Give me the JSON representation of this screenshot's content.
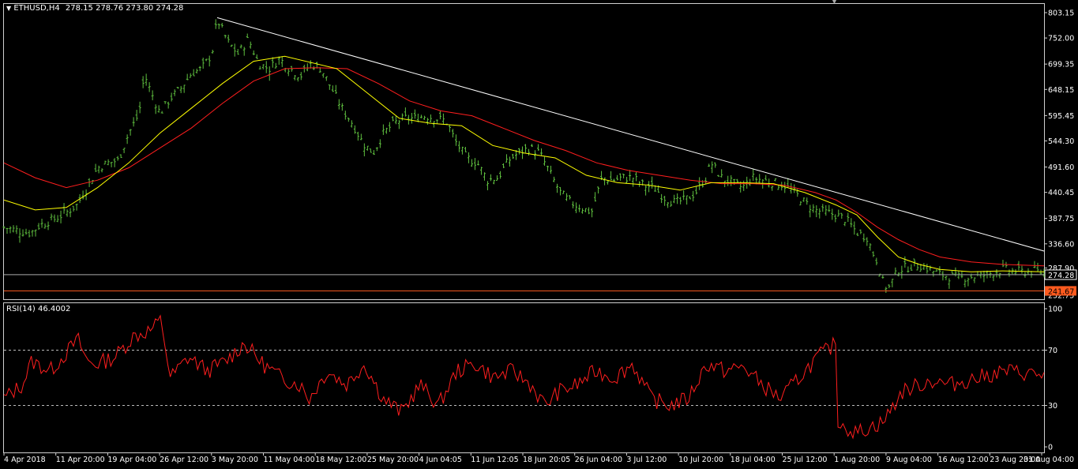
{
  "colors": {
    "background": "#000000",
    "bars": "#5fbf3f",
    "ma_fast": "#ffff00",
    "ma_slow": "#ff1e1e",
    "trendline": "#ffffff",
    "rsi": "#ff1e1e",
    "bid_line": "#aaaaaa",
    "support_line": "#ff5a1e",
    "support_tag": "#ff5a1e",
    "frame": "#cfcfcf"
  },
  "header": {
    "symbol": "ETHUSD,H4",
    "ohlc": "278.15 278.76 273.80 274.28",
    "arrow": "▼",
    "scroll_marker": "▼"
  },
  "rsi_panel": {
    "title": "RSI(14) 46.4002"
  },
  "chart_data": [
    {
      "type": "ohlc",
      "symbol": "ETHUSD",
      "timeframe": "H4",
      "ylim": [
        232.75,
        803.15
      ],
      "y_ticks": [
        "803.15",
        "752.00",
        "699.35",
        "648.15",
        "595.45",
        "544.30",
        "491.60",
        "440.45",
        "387.75",
        "336.60",
        "287.90",
        "232.75"
      ],
      "x_ticks": [
        "4 Apr 2018",
        "11 Apr 20:00",
        "19 Apr 04:00",
        "26 Apr 12:00",
        "3 May 20:00",
        "11 May 04:00",
        "18 May 12:00",
        "25 May 20:00",
        "4 Jun 04:05",
        "11 Jun 12:05",
        "18 Jun 20:05",
        "26 Jun 04:00",
        "3 Jul 12:00",
        "10 Jul 20:00",
        "18 Jul 04:00",
        "25 Jul 12:00",
        "1 Aug 20:00",
        "9 Aug 04:00",
        "16 Aug 12:00",
        "23 Aug 20:00",
        "31 Aug 04:00"
      ],
      "price_path": [
        [
          0,
          370
        ],
        [
          0.01,
          365
        ],
        [
          0.025,
          358
        ],
        [
          0.035,
          375
        ],
        [
          0.05,
          388
        ],
        [
          0.06,
          400
        ],
        [
          0.07,
          415
        ],
        [
          0.08,
          450
        ],
        [
          0.09,
          490
        ],
        [
          0.1,
          500
        ],
        [
          0.11,
          505
        ],
        [
          0.12,
          560
        ],
        [
          0.13,
          600
        ],
        [
          0.135,
          680
        ],
        [
          0.14,
          650
        ],
        [
          0.15,
          600
        ],
        [
          0.16,
          630
        ],
        [
          0.17,
          650
        ],
        [
          0.18,
          680
        ],
        [
          0.19,
          690
        ],
        [
          0.2,
          720
        ],
        [
          0.205,
          790
        ],
        [
          0.215,
          745
        ],
        [
          0.225,
          720
        ],
        [
          0.235,
          750
        ],
        [
          0.245,
          700
        ],
        [
          0.255,
          690
        ],
        [
          0.265,
          710
        ],
        [
          0.275,
          690
        ],
        [
          0.285,
          675
        ],
        [
          0.295,
          700
        ],
        [
          0.305,
          690
        ],
        [
          0.315,
          650
        ],
        [
          0.325,
          610
        ],
        [
          0.335,
          580
        ],
        [
          0.345,
          540
        ],
        [
          0.355,
          520
        ],
        [
          0.365,
          560
        ],
        [
          0.375,
          580
        ],
        [
          0.385,
          590
        ],
        [
          0.395,
          590
        ],
        [
          0.405,
          595
        ],
        [
          0.415,
          590
        ],
        [
          0.425,
          585
        ],
        [
          0.435,
          540
        ],
        [
          0.445,
          510
        ],
        [
          0.455,
          500
        ],
        [
          0.465,
          465
        ],
        [
          0.475,
          470
        ],
        [
          0.485,
          505
        ],
        [
          0.495,
          520
        ],
        [
          0.505,
          530
        ],
        [
          0.515,
          520
        ],
        [
          0.525,
          480
        ],
        [
          0.535,
          440
        ],
        [
          0.545,
          420
        ],
        [
          0.555,
          410
        ],
        [
          0.565,
          400
        ],
        [
          0.575,
          470
        ],
        [
          0.585,
          465
        ],
        [
          0.595,
          470
        ],
        [
          0.605,
          470
        ],
        [
          0.615,
          455
        ],
        [
          0.625,
          450
        ],
        [
          0.635,
          430
        ],
        [
          0.645,
          420
        ],
        [
          0.655,
          425
        ],
        [
          0.665,
          440
        ],
        [
          0.675,
          470
        ],
        [
          0.68,
          500
        ],
        [
          0.69,
          470
        ],
        [
          0.7,
          460
        ],
        [
          0.71,
          450
        ],
        [
          0.72,
          470
        ],
        [
          0.73,
          465
        ],
        [
          0.74,
          460
        ],
        [
          0.75,
          455
        ],
        [
          0.76,
          440
        ],
        [
          0.77,
          420
        ],
        [
          0.78,
          405
        ],
        [
          0.79,
          400
        ],
        [
          0.8,
          395
        ],
        [
          0.81,
          385
        ],
        [
          0.82,
          360
        ],
        [
          0.83,
          350
        ],
        [
          0.835,
          320
        ],
        [
          0.84,
          300
        ],
        [
          0.845,
          260
        ],
        [
          0.85,
          245
        ],
        [
          0.86,
          285
        ],
        [
          0.87,
          290
        ],
        [
          0.88,
          295
        ],
        [
          0.89,
          285
        ],
        [
          0.9,
          275
        ],
        [
          0.91,
          270
        ],
        [
          0.92,
          268
        ],
        [
          0.93,
          270
        ],
        [
          0.94,
          272
        ],
        [
          0.95,
          278
        ],
        [
          0.96,
          285
        ],
        [
          0.97,
          282
        ],
        [
          0.98,
          280
        ],
        [
          0.99,
          282
        ],
        [
          1,
          278
        ]
      ],
      "ma_fast_path": [
        [
          0,
          425
        ],
        [
          0.03,
          405
        ],
        [
          0.06,
          410
        ],
        [
          0.09,
          450
        ],
        [
          0.12,
          500
        ],
        [
          0.15,
          560
        ],
        [
          0.18,
          610
        ],
        [
          0.21,
          660
        ],
        [
          0.24,
          705
        ],
        [
          0.27,
          715
        ],
        [
          0.3,
          700
        ],
        [
          0.32,
          690
        ],
        [
          0.35,
          640
        ],
        [
          0.38,
          590
        ],
        [
          0.41,
          580
        ],
        [
          0.44,
          575
        ],
        [
          0.47,
          535
        ],
        [
          0.5,
          520
        ],
        [
          0.53,
          510
        ],
        [
          0.56,
          475
        ],
        [
          0.59,
          460
        ],
        [
          0.62,
          455
        ],
        [
          0.65,
          445
        ],
        [
          0.68,
          460
        ],
        [
          0.71,
          460
        ],
        [
          0.74,
          458
        ],
        [
          0.77,
          440
        ],
        [
          0.8,
          415
        ],
        [
          0.82,
          395
        ],
        [
          0.84,
          350
        ],
        [
          0.86,
          310
        ],
        [
          0.88,
          295
        ],
        [
          0.9,
          285
        ],
        [
          0.93,
          280
        ],
        [
          0.96,
          282
        ],
        [
          1,
          280
        ]
      ],
      "ma_slow_path": [
        [
          0,
          500
        ],
        [
          0.03,
          470
        ],
        [
          0.06,
          450
        ],
        [
          0.09,
          465
        ],
        [
          0.12,
          490
        ],
        [
          0.15,
          530
        ],
        [
          0.18,
          570
        ],
        [
          0.21,
          620
        ],
        [
          0.24,
          665
        ],
        [
          0.27,
          690
        ],
        [
          0.3,
          692
        ],
        [
          0.33,
          690
        ],
        [
          0.36,
          660
        ],
        [
          0.39,
          625
        ],
        [
          0.42,
          605
        ],
        [
          0.45,
          595
        ],
        [
          0.48,
          570
        ],
        [
          0.51,
          545
        ],
        [
          0.54,
          525
        ],
        [
          0.57,
          500
        ],
        [
          0.6,
          485
        ],
        [
          0.63,
          475
        ],
        [
          0.66,
          465
        ],
        [
          0.69,
          458
        ],
        [
          0.72,
          458
        ],
        [
          0.75,
          455
        ],
        [
          0.78,
          440
        ],
        [
          0.8,
          425
        ],
        [
          0.82,
          400
        ],
        [
          0.84,
          370
        ],
        [
          0.86,
          345
        ],
        [
          0.88,
          325
        ],
        [
          0.9,
          310
        ],
        [
          0.93,
          300
        ],
        [
          0.96,
          295
        ],
        [
          1,
          292
        ]
      ],
      "trendline": {
        "start": [
          0.205,
          793
        ],
        "end": [
          1,
          322
        ]
      },
      "bid_price": 274.28,
      "bid_label": "274.28",
      "support_level": 241.67,
      "support_label": "241.67"
    },
    {
      "type": "line",
      "name": "RSI(14)",
      "ylim": [
        0,
        100
      ],
      "y_ticks": [
        "100",
        "70",
        "30",
        "0"
      ],
      "levels": [
        70,
        30
      ],
      "rsi_path": [
        [
          0,
          35
        ],
        [
          0.02,
          45
        ],
        [
          0.03,
          62
        ],
        [
          0.05,
          55
        ],
        [
          0.07,
          70
        ],
        [
          0.08,
          78
        ],
        [
          0.09,
          62
        ],
        [
          0.1,
          60
        ],
        [
          0.12,
          65
        ],
        [
          0.14,
          80
        ],
        [
          0.16,
          85
        ],
        [
          0.17,
          92
        ],
        [
          0.18,
          50
        ],
        [
          0.2,
          65
        ],
        [
          0.22,
          55
        ],
        [
          0.24,
          62
        ],
        [
          0.26,
          75
        ],
        [
          0.28,
          60
        ],
        [
          0.3,
          50
        ],
        [
          0.32,
          45
        ],
        [
          0.33,
          35
        ],
        [
          0.35,
          55
        ],
        [
          0.37,
          45
        ],
        [
          0.39,
          60
        ],
        [
          0.41,
          35
        ],
        [
          0.43,
          25
        ],
        [
          0.45,
          45
        ],
        [
          0.47,
          30
        ],
        [
          0.49,
          55
        ],
        [
          0.51,
          60
        ],
        [
          0.53,
          50
        ],
        [
          0.55,
          55
        ],
        [
          0.57,
          45
        ],
        [
          0.585,
          30
        ],
        [
          0.6,
          40
        ],
        [
          0.62,
          45
        ],
        [
          0.64,
          55
        ],
        [
          0.66,
          50
        ],
        [
          0.68,
          60
        ],
        [
          0.7,
          35
        ],
        [
          0.72,
          30
        ],
        [
          0.74,
          35
        ],
        [
          0.76,
          60
        ],
        [
          0.78,
          55
        ],
        [
          0.8,
          58
        ],
        [
          0.82,
          45
        ],
        [
          0.84,
          35
        ],
        [
          0.86,
          50
        ],
        [
          0.88,
          65
        ],
        [
          0.9,
          75
        ],
        [
          0.91,
          55
        ],
        [
          0.93,
          48
        ],
        [
          0.95,
          55
        ],
        [
          0.97,
          45
        ],
        [
          1,
          45
        ]
      ],
      "rsi_path_tail": [
        [
          0,
          45
        ],
        [
          0.2,
          45
        ],
        [
          0.3,
          30
        ],
        [
          0.4,
          25
        ],
        [
          0.5,
          35
        ],
        [
          0.6,
          28
        ],
        [
          0.7,
          30
        ],
        [
          0.78,
          20
        ],
        [
          0.8,
          10
        ],
        [
          0.83,
          18
        ],
        [
          0.85,
          40
        ],
        [
          0.88,
          48
        ],
        [
          0.9,
          45
        ],
        [
          0.93,
          50
        ],
        [
          0.96,
          55
        ],
        [
          1,
          52
        ]
      ]
    }
  ]
}
